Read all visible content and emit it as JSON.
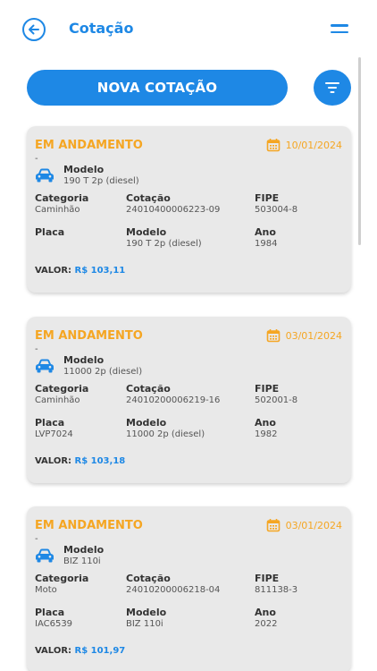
{
  "header": {
    "title": "Cotação"
  },
  "actions": {
    "new_label": "NOVA COTAÇÃO"
  },
  "labels": {
    "modelo": "Modelo",
    "categoria": "Categoria",
    "cotacao": "Cotação",
    "fipe": "FIPE",
    "placa": "Placa",
    "ano": "Ano",
    "valor": "VALOR:"
  },
  "colors": {
    "accent": "#1e88e5",
    "status": "#f5a623",
    "card_bg": "#e9e9e9"
  },
  "cards": [
    {
      "status": "EM ANDAMENTO",
      "date": "10/01/2024",
      "dash": "-",
      "modelo": "190 T 2p (diesel)",
      "categoria": "Caminhão",
      "cotacao": "24010400006223-09",
      "fipe": "503004-8",
      "placa": "",
      "modelo2": "190 T 2p (diesel)",
      "ano": "1984",
      "valor": "R$ 103,11"
    },
    {
      "status": "EM ANDAMENTO",
      "date": "03/01/2024",
      "dash": "-",
      "modelo": "11000 2p (diesel)",
      "categoria": "Caminhão",
      "cotacao": "24010200006219-16",
      "fipe": "502001-8",
      "placa": "LVP7024",
      "modelo2": "11000 2p (diesel)",
      "ano": "1982",
      "valor": "R$ 103,18"
    },
    {
      "status": "EM ANDAMENTO",
      "date": "03/01/2024",
      "dash": "-",
      "modelo": "BIZ 110i",
      "categoria": "Moto",
      "cotacao": "24010200006218-04",
      "fipe": "811138-3",
      "placa": "IAC6539",
      "modelo2": "BIZ 110i",
      "ano": "2022",
      "valor": "R$ 101,97"
    }
  ]
}
